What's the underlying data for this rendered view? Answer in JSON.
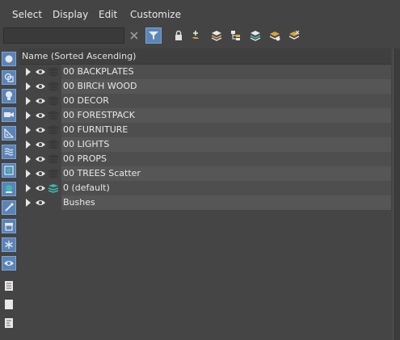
{
  "menu": {
    "select": "Select",
    "display": "Display",
    "edit": "Edit",
    "customize": "Customize"
  },
  "toolbar": {
    "search_value": "",
    "icons": [
      "close-icon",
      "filter-icon",
      "lock-icon",
      "add-layer-icon",
      "layers-stack-icon",
      "hierarchy-icon",
      "layers-icon",
      "layer-highlight-icon",
      "layer-settings-icon"
    ]
  },
  "sidebar_icons": [
    "sphere-icon",
    "geometry-icon",
    "light-bulb-icon",
    "camera-icon",
    "helper-icon",
    "space-warp-icon",
    "group-icon",
    "xref-icon",
    "bone-icon",
    "container-icon",
    "snowflake-icon",
    "eye-icon",
    "document-icon",
    "blank-page-icon",
    "list-page-icon"
  ],
  "tree": {
    "header": "Name (Sorted Ascending)",
    "rows": [
      {
        "label": "00 BACKPLATES",
        "layer_color": "#3a3a3a"
      },
      {
        "label": "00 BIRCH WOOD",
        "layer_color": "#3a3a3a"
      },
      {
        "label": "00 DECOR",
        "layer_color": "#3a3a3a"
      },
      {
        "label": "00 FORESTPACK",
        "layer_color": "#3a3a3a"
      },
      {
        "label": "00 FURNITURE",
        "layer_color": "#3a3a3a"
      },
      {
        "label": "00 LIGHTS",
        "layer_color": "#3a3a3a"
      },
      {
        "label": "00 PROPS",
        "layer_color": "#3a3a3a"
      },
      {
        "label": "00 TREES Scatter",
        "layer_color": "#3a3a3a"
      },
      {
        "label": "0 (default)",
        "layer_color": "#3fb8b0"
      },
      {
        "label": "Bushes",
        "layer_color": ""
      }
    ]
  }
}
